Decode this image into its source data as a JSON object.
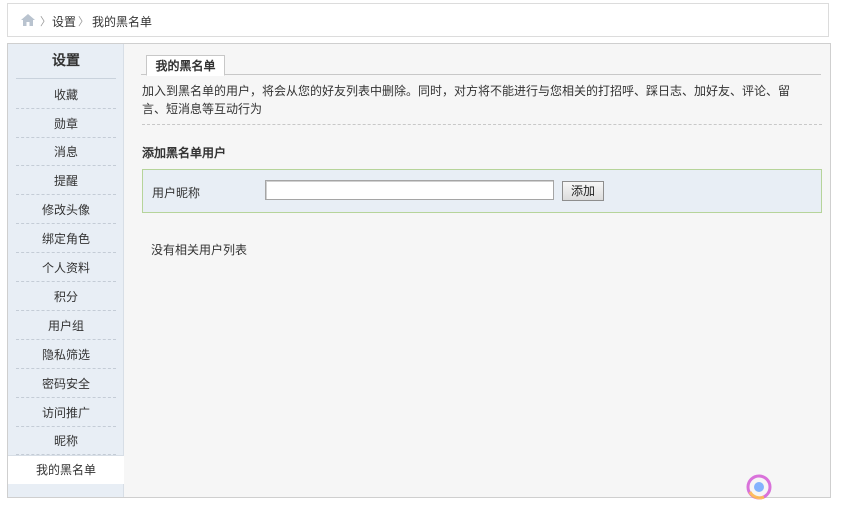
{
  "breadcrumb": {
    "items": [
      "设置",
      "我的黑名单"
    ],
    "separator": "〉"
  },
  "sidebar": {
    "title": "设置",
    "items": [
      {
        "label": "收藏"
      },
      {
        "label": "勋章"
      },
      {
        "label": "消息"
      },
      {
        "label": "提醒"
      },
      {
        "label": "修改头像"
      },
      {
        "label": "绑定角色"
      },
      {
        "label": "个人资料"
      },
      {
        "label": "积分"
      },
      {
        "label": "用户组"
      },
      {
        "label": "隐私筛选"
      },
      {
        "label": "密码安全"
      },
      {
        "label": "访问推广"
      },
      {
        "label": "昵称"
      },
      {
        "label": "我的黑名单",
        "active": true
      }
    ]
  },
  "main": {
    "tab_label": "我的黑名单",
    "description": "加入到黑名单的用户，将会从您的好友列表中删除。同时，对方将不能进行与您相关的打招呼、踩日志、加好友、评论、留言、短消息等互动行为",
    "add_section_title": "添加黑名单用户",
    "nickname_label": "用户昵称",
    "nickname_value": "",
    "add_button": "添加",
    "empty_text": "没有相关用户列表"
  },
  "watermark": {
    "logo": "watermark-logo"
  },
  "colors": {
    "sidebar_bg": "#e8eef5",
    "content_bg": "#f6f6f6",
    "addbox_border": "#b6d49a"
  }
}
